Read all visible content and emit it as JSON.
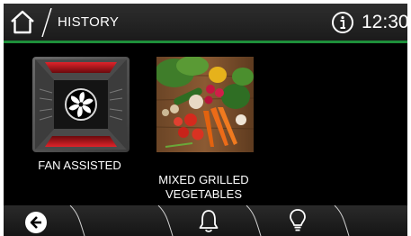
{
  "header": {
    "title": "HISTORY",
    "time": "12:30",
    "home_icon": "home-icon",
    "info_icon": "info-icon"
  },
  "recipes": [
    {
      "label": "FAN ASSISTED",
      "icon": "fan-assisted-oven-icon"
    },
    {
      "label": "MIXED GRILLED\nVEGETABLES",
      "icon": "vegetables-photo"
    }
  ],
  "footer": {
    "back_icon": "back-icon",
    "bell_icon": "bell-icon",
    "bulb_icon": "light-bulb-icon"
  },
  "colors": {
    "accent": "#1e8f3a",
    "background": "#000000",
    "heater_red": "#c0141a"
  }
}
